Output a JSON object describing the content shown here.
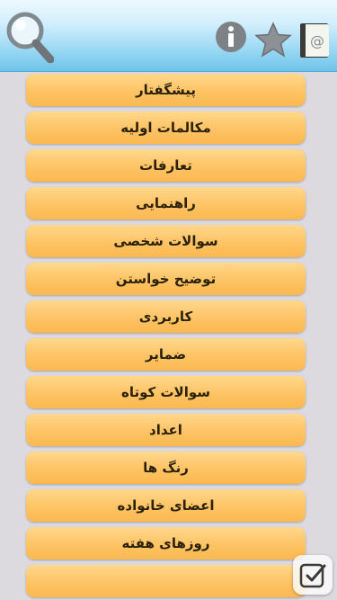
{
  "header": {
    "icons": [
      "search-icon",
      "info-icon",
      "star-icon",
      "contacts-book-icon"
    ]
  },
  "list": {
    "items": [
      "پیشگفتار",
      "مکالمات اولیه",
      "تعارفات",
      "راهنمایی",
      "سوالات شخصی",
      "توضیح خواستن",
      "کاربردی",
      "ضمایر",
      "سوالات کوتاه",
      "اعداد",
      "رنگ ها",
      "اعضای خانواده",
      "روزهای هفته"
    ]
  },
  "colors": {
    "header_top": "#eef9ff",
    "header_bottom": "#6fc3ea",
    "item_top": "#ffd98c",
    "item_bottom": "#fbb84f",
    "background": "#dcdadf"
  }
}
